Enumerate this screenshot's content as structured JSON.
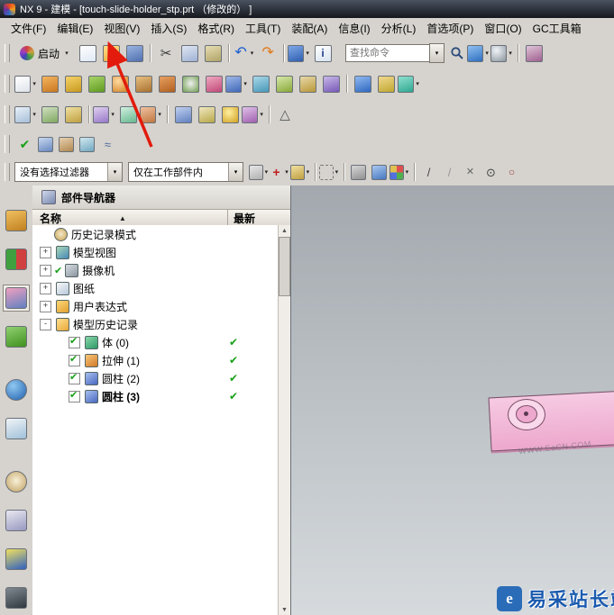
{
  "ui": {
    "dd": "▾",
    "up": "▲",
    "dn": "▼",
    "sort": "▲"
  },
  "window": {
    "title": "NX 9 - 建模 - [touch-slide-holder_stp.prt （修改的） ]"
  },
  "menubar": {
    "items": [
      {
        "label": "文件(F)"
      },
      {
        "label": "编辑(E)"
      },
      {
        "label": "视图(V)"
      },
      {
        "label": "插入(S)"
      },
      {
        "label": "格式(R)"
      },
      {
        "label": "工具(T)"
      },
      {
        "label": "装配(A)"
      },
      {
        "label": "信息(I)"
      },
      {
        "label": "分析(L)"
      },
      {
        "label": "首选项(P)"
      },
      {
        "label": "窗口(O)"
      },
      {
        "label": "GC工具箱"
      }
    ]
  },
  "toolbar_main": {
    "start_label": "启动",
    "search_placeholder": "查找命令",
    "icons1": [
      {
        "name": "new-part-button",
        "iname": "new-file-icon",
        "sty": "background:linear-gradient(160deg,#ffffff,#dfe8f4)"
      },
      {
        "name": "open-button",
        "iname": "open-folder-icon",
        "sty": "background:linear-gradient(160deg,#ffe08a,#e8a93c)"
      },
      {
        "name": "save-button",
        "iname": "save-floppy-icon",
        "sty": "background:linear-gradient(160deg,#9ab4e0,#5070b0)"
      },
      {
        "sep": "true"
      },
      {
        "name": "cut-button",
        "iname": "scissors-icon",
        "g": "✂",
        "sty": "background:transparent;border:none;color:#3a3a3a;font-size:15px"
      },
      {
        "name": "copy-button",
        "iname": "copy-icon",
        "sty": "background:linear-gradient(160deg,#dfe6f2,#9fb2d4)"
      },
      {
        "name": "paste-button",
        "iname": "paste-icon",
        "sty": "background:linear-gradient(160deg,#e6ddb2,#b0a468)"
      },
      {
        "sep": "true"
      },
      {
        "name": "undo-button",
        "iname": "undo-arrow-icon",
        "g": "↶",
        "dd": "▾",
        "sty": "background:transparent;border:none;color:#1e5fd0;font-size:16px"
      },
      {
        "name": "redo-button",
        "iname": "redo-arrow-icon",
        "g": "↷",
        "sty": "background:transparent;border:none;color:#e07818;font-size:16px"
      },
      {
        "sep": "true"
      },
      {
        "name": "view-orient-button",
        "iname": "cylinder-icon",
        "dd": "▾",
        "sty": "background:linear-gradient(160deg,#7fa8e8,#2f5fb0)"
      },
      {
        "name": "information-button",
        "iname": "information-icon",
        "g": "i",
        "sty": "background:linear-gradient(160deg,#ffffff,#d8e4f0);color:#20408f;font-weight:bold"
      }
    ],
    "icons2": [
      {
        "name": "reset-layout-button",
        "iname": "window-grid-icon",
        "dd": "▾",
        "sty": "background:linear-gradient(160deg,#8fc0f0,#2f6fc0)"
      },
      {
        "name": "render-style-button",
        "iname": "shaded-sphere-icon",
        "dd": "▾",
        "sty": "background:radial-gradient(circle at 35% 30%,#f0f4f8,#8a949c)"
      },
      {
        "sep": "true"
      },
      {
        "name": "edit-section-button",
        "iname": "clipping-icon",
        "sty": "background:linear-gradient(160deg,#e0c4d8,#9f5f8f)"
      }
    ]
  },
  "toolbar_feature": {
    "icons": [
      {
        "name": "sketch-button",
        "iname": "sketch-icon",
        "dd": "▾",
        "sty": "background:linear-gradient(160deg,#ffffff,#dfe4ea)"
      },
      {
        "name": "block-button",
        "iname": "block-icon",
        "sty": "background:linear-gradient(160deg,#f4b45f,#c87820)"
      },
      {
        "name": "cylinder-button",
        "iname": "cylinder-primitive-icon",
        "sty": "background:linear-gradient(160deg,#f4d268,#c89a20)"
      },
      {
        "name": "cone-button",
        "iname": "cone-icon",
        "sty": "background:linear-gradient(160deg,#a8d468,#5f9a20)"
      },
      {
        "name": "sphere-button",
        "iname": "sphere-icon",
        "sty": "background:radial-gradient(circle at 35% 30%,#ffd9a0,#d08020)"
      },
      {
        "name": "extrude-button",
        "iname": "extrude-icon",
        "sty": "background:linear-gradient(160deg,#e8c080,#a87030)"
      },
      {
        "name": "revolve-button",
        "iname": "revolve-icon",
        "sty": "background:linear-gradient(160deg,#e8a060,#b06020)"
      },
      {
        "name": "hole-button",
        "iname": "hole-icon",
        "sty": "background:radial-gradient(circle at 50% 45%,#f0f0f0,#6f9f4f)"
      },
      {
        "name": "pattern-feature-button",
        "iname": "pattern-icon",
        "sty": "background:linear-gradient(160deg,#f0a8c0,#c04878)"
      },
      {
        "name": "unite-button",
        "iname": "boolean-unite-icon",
        "dd": "▾",
        "sty": "background:linear-gradient(160deg,#9fb8e8,#3f68b8)"
      },
      {
        "name": "edge-blend-button",
        "iname": "edge-blend-icon",
        "sty": "background:linear-gradient(160deg,#a8d8e8,#4898b8)"
      },
      {
        "name": "chamfer-button",
        "iname": "chamfer-icon",
        "sty": "background:linear-gradient(160deg,#d8e8a8,#88a838)"
      },
      {
        "name": "shell-button",
        "iname": "shell-icon",
        "sty": "background:linear-gradient(160deg,#e8d8a8,#b89838)"
      },
      {
        "name": "trim-body-button",
        "iname": "trim-body-icon",
        "sty": "background:linear-gradient(160deg,#c8b8e8,#7858b8)"
      },
      {
        "sep": "true"
      },
      {
        "name": "assembly-constraints-button",
        "iname": "constraints-icon",
        "sty": "background:linear-gradient(160deg,#8fb8f0,#2f68c0)"
      },
      {
        "name": "move-component-button",
        "iname": "move-component-icon",
        "sty": "background:linear-gradient(160deg,#f0d88f,#c0a82f)"
      },
      {
        "name": "wave-link-button",
        "iname": "wave-link-icon",
        "dd": "▾",
        "sty": "background:linear-gradient(160deg,#8fe0d0,#2fa890)"
      }
    ]
  },
  "toolbar_datum": {
    "icons": [
      {
        "name": "datum-plane-button",
        "iname": "datum-plane-icon",
        "dd": "▾",
        "sty": "background:linear-gradient(160deg,#e8f0f8,#a8c0d8)"
      },
      {
        "name": "datum-csys-button",
        "iname": "datum-csys-icon",
        "sty": "background:linear-gradient(160deg,#d0e0c0,#80a860)"
      },
      {
        "name": "point-button",
        "iname": "point-icon",
        "sty": "background:linear-gradient(160deg,#f0e0a0,#c0a040)"
      },
      {
        "sep": "true"
      },
      {
        "name": "measure-distance-button",
        "iname": "measure-distance-icon",
        "dd": "▾",
        "sty": "background:linear-gradient(160deg,#e0d0f0,#9878c8)"
      },
      {
        "name": "measure-angle-button",
        "iname": "measure-angle-icon",
        "sty": "background:linear-gradient(160deg,#d0f0e0,#68b890)"
      },
      {
        "name": "move-face-button",
        "iname": "move-face-icon",
        "dd": "▾",
        "sty": "background:linear-gradient(160deg,#f0c0a0,#c07840)"
      },
      {
        "sep": "true"
      },
      {
        "name": "display-mode-button",
        "iname": "display-mode-icon",
        "sty": "background:linear-gradient(160deg,#c0d0f0,#6080c0)"
      },
      {
        "name": "layer-settings-button",
        "iname": "layers-icon",
        "sty": "background:linear-gradient(160deg,#f0e8c0,#b8a848)"
      },
      {
        "name": "show-hide-button",
        "iname": "show-hide-icon",
        "sty": "background:radial-gradient(circle at 40% 35%,#fff0a0,#d0a020)"
      },
      {
        "name": "object-display-button",
        "iname": "object-display-icon",
        "dd": "▾",
        "sty": "background:linear-gradient(160deg,#e0c0e8,#a060b0)"
      },
      {
        "sep": "true"
      },
      {
        "name": "snap-angle-button",
        "iname": "triangle-icon",
        "g": "△",
        "sty": "background:transparent;border:none;color:#555;font-size:15px"
      }
    ]
  },
  "toolbar_check": {
    "icons": [
      {
        "name": "examine-geometry-button",
        "iname": "green-check-icon",
        "g": "✔",
        "sty": "background:transparent;border:none;color:#18a018;font-size:14px"
      },
      {
        "name": "deviation-gauge-button",
        "iname": "gauge-icon",
        "sty": "background:linear-gradient(160deg,#c8d8f0,#6888c0)"
      },
      {
        "name": "section-analysis-button",
        "iname": "section-icon",
        "sty": "background:linear-gradient(160deg,#e8d0b0,#b08850)"
      },
      {
        "name": "reflection-analysis-button",
        "iname": "reflection-icon",
        "sty": "background:linear-gradient(160deg,#d0e8f0,#70a8c0)"
      },
      {
        "name": "curve-analysis-button",
        "iname": "curve-analysis-icon",
        "g": "≈",
        "sty": "background:transparent;border:none;color:#4a6a9a;font-size:13px"
      }
    ]
  },
  "selection_bar": {
    "filter": "没有选择过滤器",
    "scope": "仅在工作部件内",
    "icons": [
      {
        "name": "filter-face-button",
        "iname": "face-filter-icon",
        "dd": "▾",
        "sty": "background:linear-gradient(160deg,#e8e8e8,#b0b0b0)"
      },
      {
        "name": "add-to-selection-button",
        "iname": "plus-icon",
        "g": "+",
        "dd": "▾",
        "sty": "background:transparent;border:none;color:#c02020;font-weight:bold;font-size:14px"
      },
      {
        "name": "highlight-button",
        "iname": "highlight-icon",
        "dd": "▾",
        "sty": "background:linear-gradient(160deg,#f0e0a0,#c0a040)"
      },
      {
        "sep": "true"
      },
      {
        "name": "marquee-select-button",
        "iname": "marquee-icon",
        "dd": "▾",
        "sty": "background:transparent;border:1px dashed #777"
      },
      {
        "sep": "true"
      },
      {
        "name": "show-shaded-button",
        "iname": "gray-cube-icon",
        "sty": "background:linear-gradient(160deg,#d8d8d8,#909090)"
      },
      {
        "name": "show-wireframe-button",
        "iname": "blue-cube-icon",
        "sty": "background:linear-gradient(160deg,#a8c8f0,#4878c0)"
      },
      {
        "name": "snap-points-button",
        "iname": "snap-points-icon",
        "dd": "▾",
        "sty": "background:conic-gradient(#e05050 0 25%,#50b050 0 50%,#5070e0 0 75%,#e0c050 0)"
      },
      {
        "sep": "true"
      },
      {
        "name": "snap-end-button",
        "iname": "endpoint-icon",
        "g": "/",
        "sty": "background:transparent;border:none;color:#444;font-size:13px"
      },
      {
        "name": "snap-mid-button",
        "iname": "midpoint-icon",
        "g": "/",
        "sty": "background:transparent;border:none;color:#999;font-size:13px"
      },
      {
        "name": "snap-intersection-button",
        "iname": "intersection-icon",
        "g": "✕",
        "sty": "background:transparent;border:none;color:#666"
      },
      {
        "name": "snap-center-button",
        "iname": "center-point-icon",
        "g": "⊙",
        "sty": "background:transparent;border:none;color:#444;font-size:13px"
      },
      {
        "name": "snap-quadrant-button",
        "iname": "quadrant-icon",
        "g": "○",
        "sty": "background:transparent;border:none;color:#a04040;font-size:12px"
      }
    ]
  },
  "resource_bar": {
    "items": [
      {
        "name": "assembly-navigator-tab",
        "iname": "assembly-navigator-icon",
        "sty": "background:linear-gradient(160deg,#f0c060,#c08020)"
      },
      {
        "name": "constraint-navigator-tab",
        "iname": "constraint-navigator-icon",
        "sty": "conic-gradient(#d04040 0 50%,#40a040 0);background:conic-gradient(#d04040 0 50%,#40a040 0)"
      },
      {
        "name": "part-navigator-tab",
        "iname": "part-navigator-icon",
        "active": "true",
        "sty": "background:linear-gradient(160deg,#f0a0c0,#6080c0)"
      },
      {
        "name": "reuse-library-tab",
        "iname": "reuse-library-icon",
        "sty": "background:linear-gradient(160deg,#90d070,#409020)"
      },
      {
        "name": "hd3d-tools-tab",
        "iname": "hd3d-icon",
        "gap": "true",
        "sty": "background:radial-gradient(circle at 35% 30%,#90c8f0,#2060b0);border-radius:50%"
      },
      {
        "name": "web-browser-tab",
        "iname": "web-browser-icon",
        "sty": "background:linear-gradient(160deg,#f0f4f8,#a0c0d8)"
      },
      {
        "name": "history-tab",
        "iname": "history-clock-icon",
        "gap": "true",
        "sty": "background:radial-gradient(circle at 50% 45%,#f8f0d8,#c0a060);border-radius:50%"
      },
      {
        "name": "process-studio-tab",
        "iname": "process-studio-icon",
        "sty": "background:linear-gradient(160deg,#e8e8f0,#9898c0)"
      },
      {
        "name": "manufacturing-wizard-tab",
        "iname": "manufacturing-icon",
        "sty": "background:linear-gradient(160deg,#f0e060,#3060c0)"
      },
      {
        "name": "roles-tab",
        "iname": "roles-icon",
        "sty": "background:linear-gradient(160deg,#808890,#303840)"
      }
    ]
  },
  "navigator": {
    "title": "部件导航器",
    "columns": [
      "名称",
      "最新"
    ],
    "items": [
      {
        "label": "历史记录模式",
        "level": "0",
        "exp": "",
        "iname": "history-mode-icon",
        "sty": "background:radial-gradient(circle at 50% 45%,#f4e8c8,#c8a050);border-radius:50%"
      },
      {
        "label": "模型视图",
        "level": "0",
        "exp": "+",
        "iname": "model-views-icon",
        "sty": "background:linear-gradient(145deg,#a8d8b8,#4888b8)"
      },
      {
        "label": "摄像机",
        "level": "0",
        "exp": "+",
        "pre": "✔",
        "iname": "camera-icon",
        "sty": "background:linear-gradient(145deg,#d8dde2,#8a949e)"
      },
      {
        "label": "图纸",
        "level": "0",
        "exp": "+",
        "iname": "drawing-sheet-icon",
        "sty": "background:linear-gradient(145deg,#f8f8f8,#b8c8dc)"
      },
      {
        "label": "用户表达式",
        "level": "0",
        "exp": "+",
        "iname": "folder-icon",
        "sty": "background:linear-gradient(145deg,#ffd878,#e0a030)"
      },
      {
        "label": "模型历史记录",
        "level": "0",
        "exp": "-",
        "iname": "open-folder-icon",
        "sty": "background:linear-gradient(145deg,#ffe090,#e8a838)"
      },
      {
        "label": "体 (0)",
        "level": "1",
        "cb": "true",
        "cbg": "✔",
        "iname": "body-feature-icon",
        "latest": "✔",
        "sty": "background:linear-gradient(145deg,#88d8a8,#2f9868)"
      },
      {
        "label": "拉伸 (1)",
        "level": "1",
        "cb": "true",
        "cbg": "✔",
        "iname": "extrude-feature-icon",
        "latest": "✔",
        "sty": "background:linear-gradient(145deg,#f8c878,#d07828)"
      },
      {
        "label": "圆柱 (2)",
        "level": "1",
        "cb": "true",
        "cbg": "✔",
        "iname": "cylinder-feature-icon",
        "latest": "✔",
        "sty": "background:linear-gradient(145deg,#a8c0f0,#4868c0)"
      },
      {
        "label": "圆柱 (3)",
        "level": "1",
        "cb": "true",
        "cbg": "✔",
        "iname": "cylinder-feature-icon",
        "latest": "✔",
        "selected": "true",
        "sty": "background:linear-gradient(145deg,#a8c0f0,#4868c0)"
      }
    ]
  },
  "graphics": {
    "part_color": "#f2b6d8",
    "part_edge": "#7a4e68"
  },
  "watermark": {
    "text": "易采站长站",
    "faint": "WWW.EaCN.COM",
    "logo_letter": "e",
    "color": "#1a5aae"
  },
  "annotation": {
    "color": "#e21b0c",
    "target": "编辑(E)"
  }
}
